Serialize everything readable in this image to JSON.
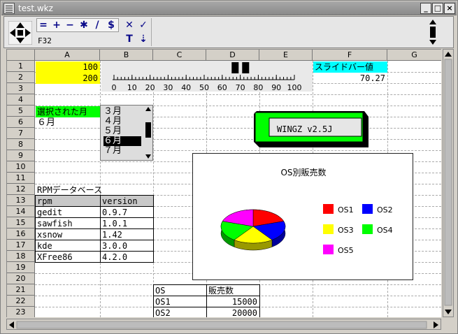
{
  "window": {
    "title": "test.wkz"
  },
  "toolbar": {
    "tools": [
      "=",
      "+",
      "−",
      "✱",
      "/",
      "$"
    ],
    "cancel": "✕",
    "confirm": "✓",
    "text_tool": "T",
    "import_tool": "⇣",
    "cell_ref": "F32"
  },
  "sheet": {
    "columns": [
      "A",
      "B",
      "C",
      "D",
      "E",
      "F",
      "G"
    ],
    "rows": [
      "1",
      "2",
      "3",
      "4",
      "5",
      "6",
      "7",
      "8",
      "9",
      "10",
      "11",
      "12",
      "13",
      "14",
      "15",
      "16",
      "17",
      "18",
      "19",
      "20",
      "21",
      "22",
      "23"
    ],
    "a1": "100",
    "a2": "200",
    "f1": "スライドバー値",
    "f2": "70.27",
    "a5": "選択された月",
    "a6": "６月",
    "a12": "RPMデータベース",
    "rpm_header": [
      "rpm",
      "version"
    ],
    "rpm_rows": [
      [
        "gedit",
        "0.9.7"
      ],
      [
        "sawfish",
        "1.0.1"
      ],
      [
        "xsnow",
        "1.42"
      ],
      [
        "kde",
        "3.0.0"
      ],
      [
        "XFree86",
        "4.2.0"
      ]
    ],
    "os_header": [
      "OS",
      "販売数"
    ],
    "os_rows": [
      [
        "OS1",
        "15000"
      ],
      [
        "OS2",
        "20000"
      ]
    ]
  },
  "slider": {
    "value": 70.27,
    "min": 0,
    "max": 100,
    "labels": [
      "0",
      "10",
      "20",
      "30",
      "40",
      "50",
      "60",
      "70",
      "80",
      "90",
      "100"
    ]
  },
  "listbox": {
    "items": [
      "３月",
      "４月",
      "５月",
      "６月",
      "７月"
    ],
    "selected": "６月"
  },
  "wingz_box": {
    "text": "WINGZ v2.5J"
  },
  "chart_data": {
    "type": "pie",
    "title": "OS別販売数",
    "labels": [
      "OS1",
      "OS2",
      "OS3",
      "OS4",
      "OS5"
    ],
    "colors": [
      "#ff0000",
      "#0000ff",
      "#ffff00",
      "#00ff00",
      "#ff00ff"
    ]
  }
}
